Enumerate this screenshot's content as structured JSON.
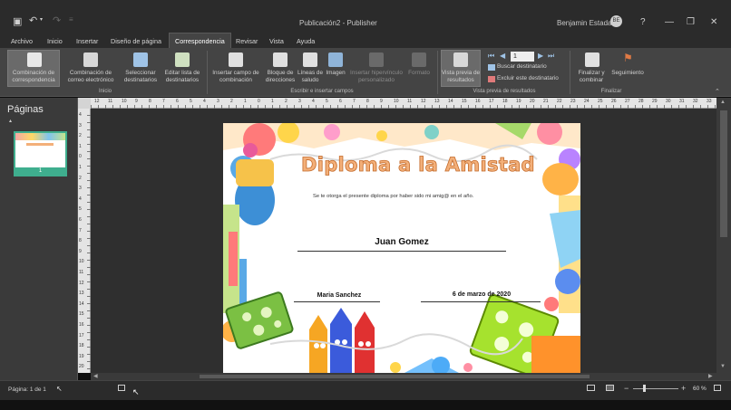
{
  "window": {
    "title": "Publicación2  -  Publisher",
    "user_name": "Benjamin Estada",
    "user_initials": "BE",
    "undo_label": "↶",
    "minimize": "—",
    "restore": "❐",
    "close": "✕",
    "help": "?"
  },
  "tabs": [
    "Archivo",
    "Inicio",
    "Insertar",
    "Diseño de página",
    "Correspondencia",
    "Revisar",
    "Vista",
    "Ayuda"
  ],
  "active_tab": "Correspondencia",
  "ribbon": {
    "combinacion_correspondencia": "Combinación de correspondencia",
    "combinacion_correo": "Combinación de correo electrónico",
    "seleccionar_destinatarios": "Seleccionar destinatarios",
    "editar_lista": "Editar lista de destinatarios",
    "insertar_campo": "Insertar campo de combinación",
    "bloque_direcciones": "Bloque de direcciones",
    "lineas_saludo": "Líneas de saludo",
    "imagen": "Imagen",
    "insertar_hipervinculo": "Insertar hipervínculo personalizado",
    "formato": "Formato",
    "vista_previa": "Vista previa de resultados",
    "record_number": "1",
    "buscar_destinatario": "Buscar destinatario",
    "excluir_destinatario": "Excluir este destinatario",
    "finalizar": "Finalizar y combinar",
    "seguimiento": "Seguimiento",
    "groups": {
      "inicio": "Inicio",
      "escribir": "Escribir e insertar campos",
      "vista_previa": "Vista previa de resultados",
      "finalizar": "Finalizar"
    }
  },
  "pages_pane": {
    "title": "Páginas",
    "thumb_number": "1"
  },
  "diploma": {
    "title": "Diploma a la Amistad",
    "body": "Se te otorga el presente diploma por haber sido mi amig@ en el año.",
    "recipient": "Juan Gomez",
    "signer": "Maria Sanchez",
    "date": "6 de marzo de 2020"
  },
  "rulers": {
    "horizontal": [
      "12",
      "11",
      "10",
      "9",
      "8",
      "7",
      "6",
      "5",
      "4",
      "3",
      "2",
      "1",
      "0",
      "1",
      "2",
      "3",
      "4",
      "5",
      "6",
      "7",
      "8",
      "9",
      "10",
      "11",
      "12",
      "13",
      "14",
      "15",
      "16",
      "17",
      "18",
      "19",
      "20",
      "21",
      "22",
      "23",
      "24",
      "25",
      "26",
      "27",
      "28",
      "29",
      "30",
      "31",
      "32",
      "33"
    ],
    "vertical": [
      "4",
      "3",
      "2",
      "1",
      "0",
      "1",
      "2",
      "3",
      "4",
      "5",
      "6",
      "7",
      "8",
      "9",
      "10",
      "11",
      "12",
      "13",
      "14",
      "15",
      "16",
      "17",
      "18",
      "19",
      "20"
    ]
  },
  "status": {
    "page_info": "Página: 1 de 1",
    "zoom": "60 %",
    "zoom_minus": "−",
    "zoom_plus": "+"
  },
  "colors": {
    "title_fill": "#f3b07a",
    "title_stroke": "#c46a2a",
    "thumb_border": "#3fae8e"
  }
}
